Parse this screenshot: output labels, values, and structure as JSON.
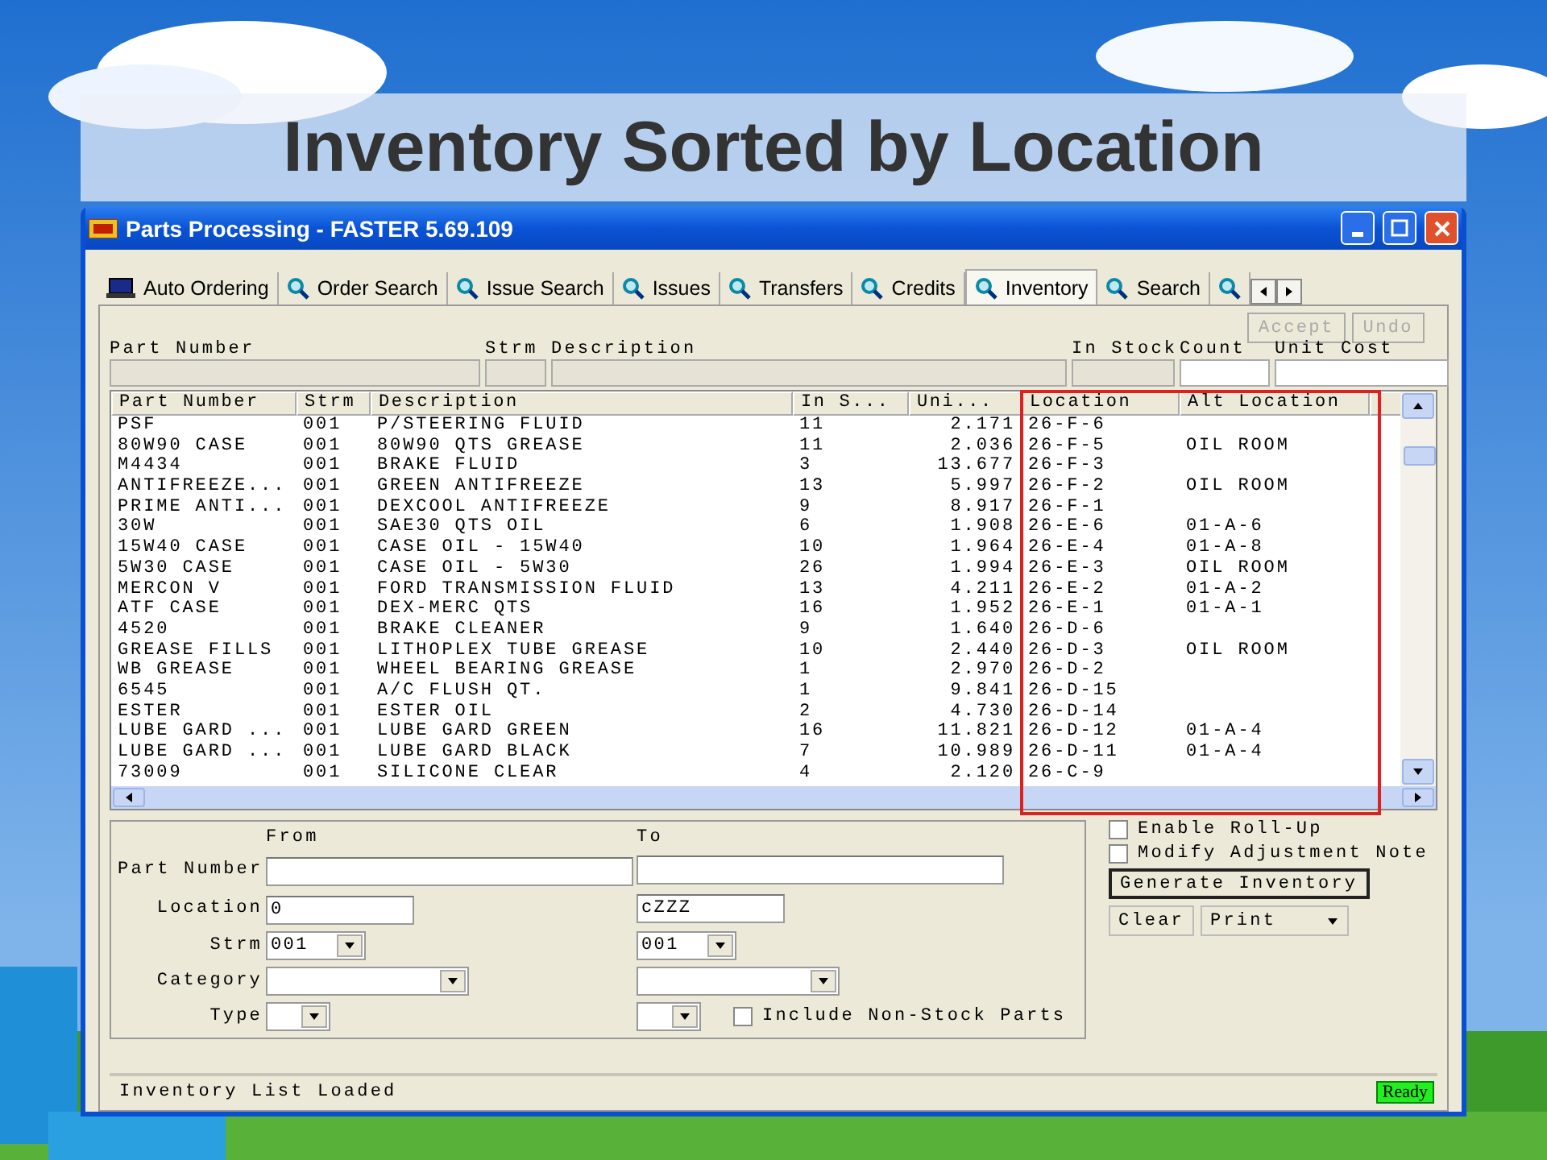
{
  "slide_title": "Inventory Sorted by Location",
  "window": {
    "title": "Parts Processing - FASTER 5.69.109"
  },
  "tabs": [
    {
      "label": "Auto Ordering",
      "selected": false
    },
    {
      "label": "Order Search",
      "selected": false
    },
    {
      "label": "Issue Search",
      "selected": false
    },
    {
      "label": "Issues",
      "selected": false
    },
    {
      "label": "Transfers",
      "selected": false
    },
    {
      "label": "Credits",
      "selected": false
    },
    {
      "label": "Inventory",
      "selected": true
    },
    {
      "label": "Search",
      "selected": false
    },
    {
      "selected": false
    }
  ],
  "edit_buttons": [
    {
      "label": "Accept",
      "disabled": true
    },
    {
      "label": "Undo",
      "disabled": true
    }
  ],
  "edit_fields": [
    {
      "label": "Part Number",
      "disabled": true
    },
    {
      "label": "Strm",
      "disabled": true
    },
    {
      "label": "Description",
      "disabled": true
    },
    {
      "label": "In Stock",
      "disabled": true
    },
    {
      "label": "Count",
      "disabled": false
    },
    {
      "label": "Unit Cost",
      "disabled": false
    }
  ],
  "table": {
    "columns": [
      {
        "label": "Part Number",
        "highlighted": false
      },
      {
        "label": "Strm",
        "highlighted": false
      },
      {
        "label": "Description",
        "highlighted": false
      },
      {
        "label": "In S...",
        "highlighted": false
      },
      {
        "label": "Uni...",
        "highlighted": false
      },
      {
        "label": "Location",
        "highlighted": true
      },
      {
        "label": "Alt Location",
        "highlighted": true
      }
    ],
    "rows": [
      [
        "PSF",
        "001",
        "P/STEERING FLUID",
        "11",
        "2.171",
        "26-F-6",
        ""
      ],
      [
        "80W90 CASE",
        "001",
        "80W90 QTS GREASE",
        "11",
        "2.036",
        "26-F-5",
        "OIL ROOM"
      ],
      [
        "M4434",
        "001",
        "BRAKE FLUID",
        "3",
        "13.677",
        "26-F-3",
        ""
      ],
      [
        "ANTIFREEZE...",
        "001",
        "GREEN ANTIFREEZE",
        "13",
        "5.997",
        "26-F-2",
        "OIL ROOM"
      ],
      [
        "PRIME ANTI...",
        "001",
        "DEXCOOL ANTIFREEZE",
        "9",
        "8.917",
        "26-F-1",
        ""
      ],
      [
        "30W",
        "001",
        "SAE30 QTS OIL",
        "6",
        "1.908",
        "26-E-6",
        "01-A-6"
      ],
      [
        "15W40 CASE",
        "001",
        "CASE OIL - 15W40",
        "10",
        "1.964",
        "26-E-4",
        "01-A-8"
      ],
      [
        "5W30 CASE",
        "001",
        "CASE OIL - 5W30",
        "26",
        "1.994",
        "26-E-3",
        "OIL ROOM"
      ],
      [
        "MERCON V",
        "001",
        "FORD TRANSMISSION FLUID",
        "13",
        "4.211",
        "26-E-2",
        "01-A-2"
      ],
      [
        "ATF CASE",
        "001",
        "DEX-MERC QTS",
        "16",
        "1.952",
        "26-E-1",
        "01-A-1"
      ],
      [
        "4520",
        "001",
        "BRAKE CLEANER",
        "9",
        "1.640",
        "26-D-6",
        ""
      ],
      [
        "GREASE FILLS",
        "001",
        "LITHOPLEX TUBE GREASE",
        "10",
        "2.440",
        "26-D-3",
        "OIL ROOM"
      ],
      [
        "WB GREASE",
        "001",
        "WHEEL BEARING GREASE",
        "1",
        "2.970",
        "26-D-2",
        ""
      ],
      [
        "6545",
        "001",
        "A/C FLUSH QT.",
        "1",
        "9.841",
        "26-D-15",
        ""
      ],
      [
        "ESTER",
        "001",
        "ESTER OIL",
        "2",
        "4.730",
        "26-D-14",
        ""
      ],
      [
        "LUBE GARD ...",
        "001",
        "LUBE GARD GREEN",
        "16",
        "11.821",
        "26-D-12",
        "01-A-4"
      ],
      [
        "LUBE GARD ...",
        "001",
        "LUBE GARD BLACK",
        "7",
        "10.989",
        "26-D-11",
        "01-A-4"
      ],
      [
        "73009",
        "001",
        "SILICONE CLEAR",
        "4",
        "2.120",
        "26-C-9",
        ""
      ]
    ]
  },
  "filters": {
    "from_label": "From",
    "to_label": "To",
    "rows": [
      {
        "label": "Part Number",
        "kind": "text"
      },
      {
        "label": "Location",
        "kind": "text",
        "from": "0",
        "to": "cZZZ"
      },
      {
        "label": "Strm",
        "kind": "select",
        "from": "001",
        "to": "001"
      },
      {
        "label": "Category",
        "kind": "select"
      },
      {
        "label": "Type",
        "kind": "select",
        "checkbox": {
          "label": "Include Non-Stock Parts",
          "checked": false
        }
      }
    ]
  },
  "options": [
    {
      "label": "Enable Roll-Up",
      "checked": false
    },
    {
      "label": "Modify Adjustment Note",
      "checked": false
    }
  ],
  "actions": [
    {
      "label": "Generate Inventory",
      "kind": "default"
    },
    {
      "label": "Clear",
      "kind": "plain"
    },
    {
      "label": "Print",
      "kind": "split"
    }
  ],
  "status": {
    "message": "Inventory List Loaded",
    "state": "Ready"
  }
}
